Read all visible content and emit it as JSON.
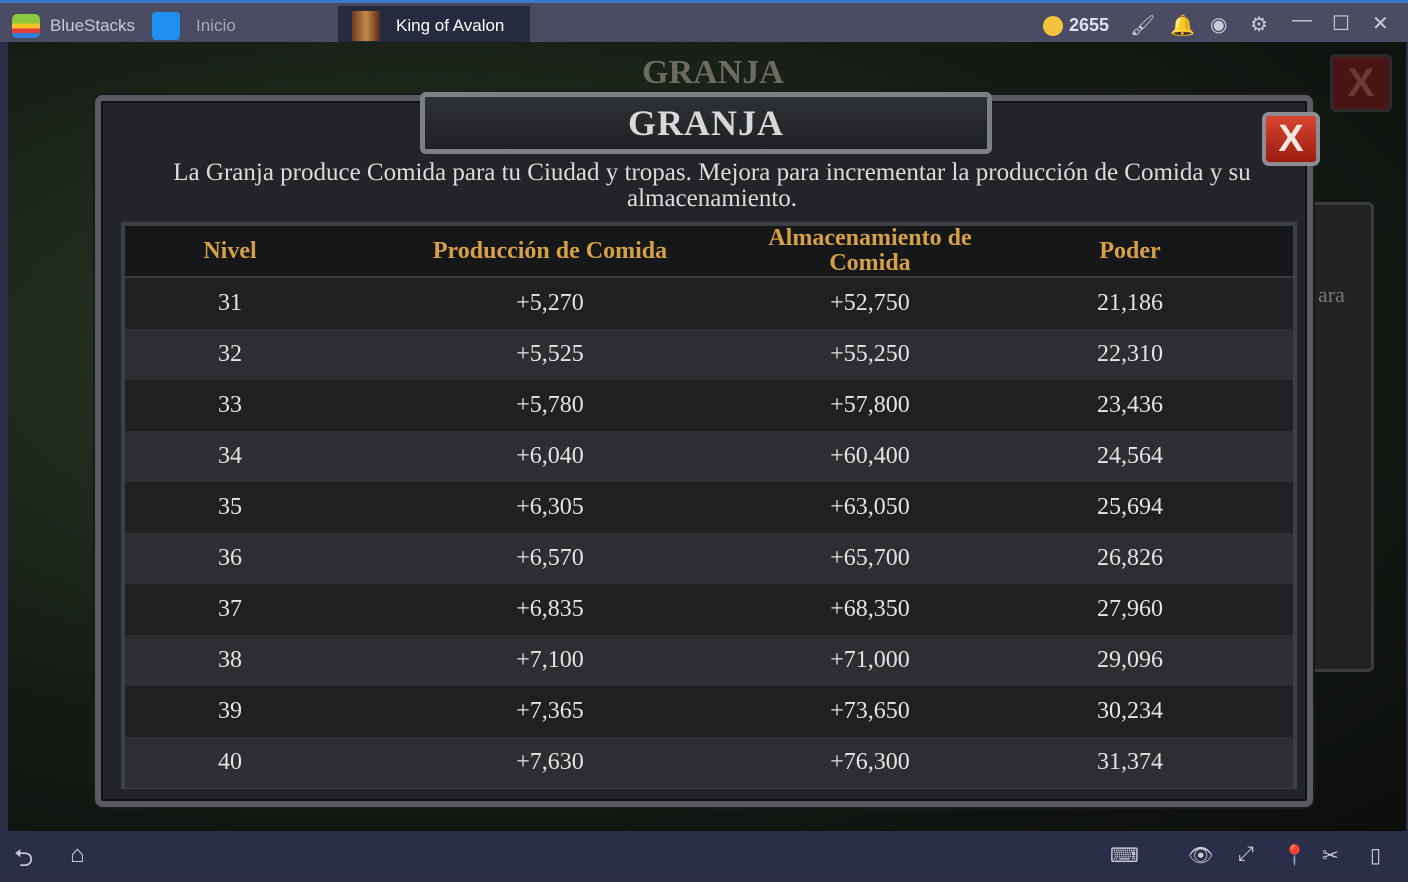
{
  "app": {
    "name": "BlueStacks",
    "tabs": [
      {
        "label": "Inicio"
      },
      {
        "label": "King of Avalon"
      }
    ],
    "coins": "2655",
    "icons": [
      "brush-icon",
      "bell-icon",
      "account-icon",
      "gear-icon",
      "minimize-icon",
      "maximize-icon",
      "close-icon"
    ],
    "accent": "#3b78c9"
  },
  "background": {
    "title": "GRANJA",
    "fragment": "ara"
  },
  "dialog": {
    "title": "GRANJA",
    "close_label": "X",
    "description": "La Granja produce Comida para tu Ciudad y tropas. Mejora para incrementar la producción de Comida y su almacenamiento.",
    "columns": [
      "Nivel",
      "Producción de Comida",
      "Almacenamiento de Comida",
      "Poder"
    ],
    "rows": [
      [
        "31",
        "+5,270",
        "+52,750",
        "21,186"
      ],
      [
        "32",
        "+5,525",
        "+55,250",
        "22,310"
      ],
      [
        "33",
        "+5,780",
        "+57,800",
        "23,436"
      ],
      [
        "34",
        "+6,040",
        "+60,400",
        "24,564"
      ],
      [
        "35",
        "+6,305",
        "+63,050",
        "25,694"
      ],
      [
        "36",
        "+6,570",
        "+65,700",
        "26,826"
      ],
      [
        "37",
        "+6,835",
        "+68,350",
        "27,960"
      ],
      [
        "38",
        "+7,100",
        "+71,000",
        "29,096"
      ],
      [
        "39",
        "+7,365",
        "+73,650",
        "30,234"
      ],
      [
        "40",
        "+7,630",
        "+76,300",
        "31,374"
      ]
    ]
  },
  "bottom_icons": [
    "back-icon",
    "home-icon",
    "keyboard-icon",
    "eye-icon",
    "fullscreen-icon",
    "location-icon",
    "scissors-icon",
    "rotate-icon"
  ]
}
